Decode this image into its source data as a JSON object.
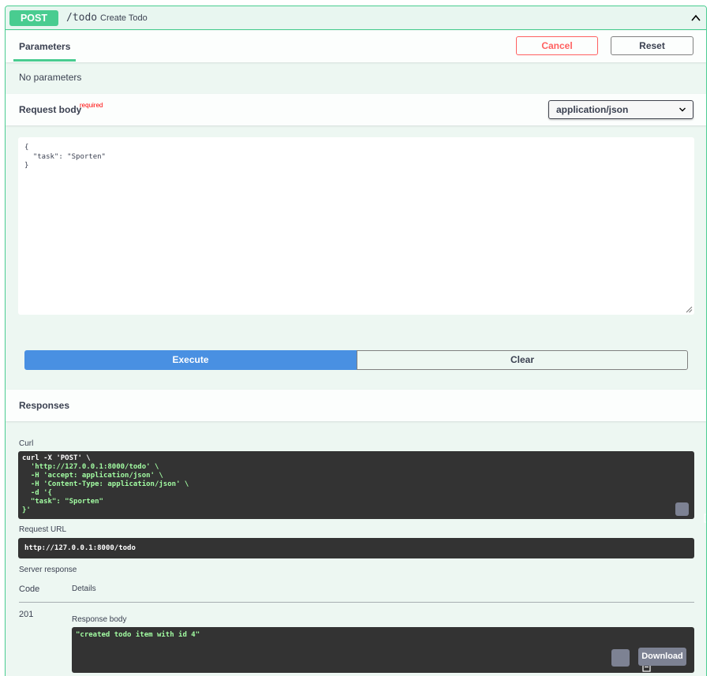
{
  "operation": {
    "method": "POST",
    "path": "/todo",
    "summary": "Create Todo"
  },
  "parameters": {
    "tab_label": "Parameters",
    "cancel_label": "Cancel",
    "reset_label": "Reset",
    "empty_text": "No parameters"
  },
  "request_body": {
    "title": "Request body",
    "required_label": "required",
    "content_type": "application/json",
    "value": "{\n  \"task\": \"Sporten\"\n}"
  },
  "actions": {
    "execute_label": "Execute",
    "clear_label": "Clear"
  },
  "responses": {
    "title": "Responses",
    "curl_label": "Curl",
    "curl_lines": [
      "curl -X 'POST' \\",
      "  'http://127.0.0.1:8000/todo' \\",
      "  -H 'accept: application/json' \\",
      "  -H 'Content-Type: application/json' \\",
      "  -d '{",
      "  \"task\": \"Sporten\"",
      "}'"
    ],
    "request_url_label": "Request URL",
    "request_url": "http://127.0.0.1:8000/todo",
    "server_response_label": "Server response",
    "code_header": "Code",
    "details_header": "Details",
    "status_code": "201",
    "response_body_label": "Response body",
    "response_body": "\"created todo item with id 4\"",
    "download_label": "Download"
  },
  "colors": {
    "post": "#49cc90",
    "execute": "#4990e2",
    "cancel": "#ff6060",
    "code_bg": "#333333"
  }
}
